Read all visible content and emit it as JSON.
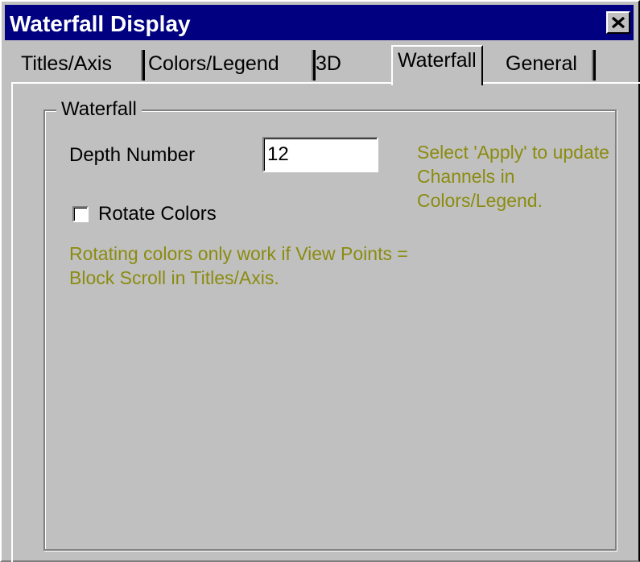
{
  "window": {
    "title": "Waterfall Display",
    "close_label": "×"
  },
  "tabs": [
    {
      "label": "Titles/Axis"
    },
    {
      "label": "Colors/Legend"
    },
    {
      "label": "3D"
    },
    {
      "label": "Waterfall",
      "active": true
    },
    {
      "label": "General"
    }
  ],
  "group": {
    "label": "Waterfall",
    "depth_label": "Depth Number",
    "depth_value": "12",
    "apply_hint": "Select 'Apply' to update Channels in Colors/Legend.",
    "rotate_label": "Rotate Colors",
    "rotate_checked": false,
    "rotate_hint": "Rotating colors only work if View Points = Block Scroll in Titles/Axis."
  },
  "colors": {
    "titlebar": "#000080",
    "hint_text": "#8b8b10",
    "face": "#c0c0c0"
  }
}
